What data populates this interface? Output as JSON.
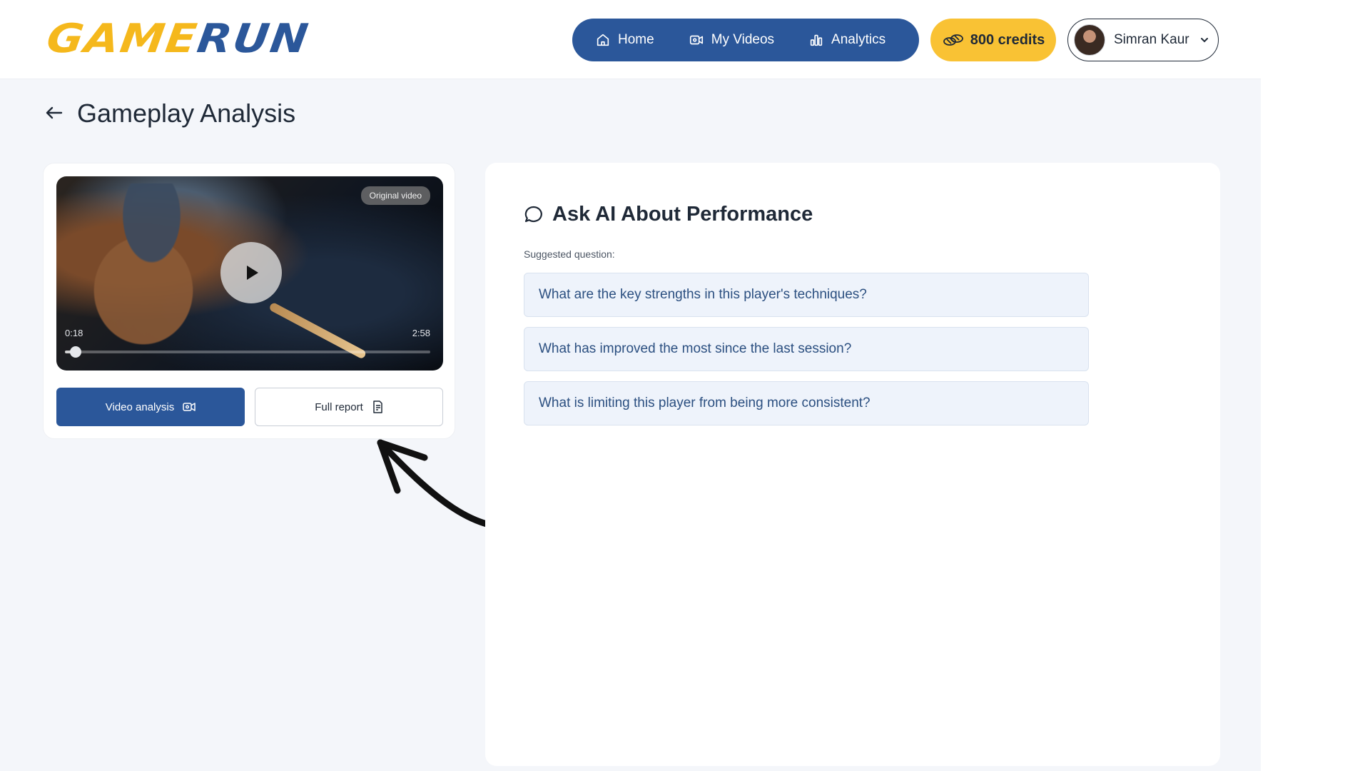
{
  "header": {
    "logo": {
      "part1": "GAME",
      "part2": "RUN"
    },
    "nav": [
      {
        "label": "Home",
        "icon": "home-icon"
      },
      {
        "label": "My Videos",
        "icon": "video-icon"
      },
      {
        "label": "Analytics",
        "icon": "bar-chart-icon"
      }
    ],
    "credits_label": "800 credits",
    "user_name": "Simran Kaur"
  },
  "page": {
    "title": "Gameplay Analysis"
  },
  "video": {
    "badge": "Original video",
    "current_time": "0:18",
    "total_time": "2:58",
    "progress": 0.03,
    "analysis_button": "Video analysis",
    "report_button": "Full report"
  },
  "ai": {
    "title": "Ask AI About Performance",
    "suggested_label": "Suggested question:",
    "questions": [
      "What are the key strengths in this player's techniques?",
      "What has improved the most since the last session?",
      "What is limiting this player from being more consistent?"
    ]
  },
  "colors": {
    "brand_blue": "#2b579a",
    "brand_yellow": "#f9c234",
    "background": "#f4f6fa"
  }
}
